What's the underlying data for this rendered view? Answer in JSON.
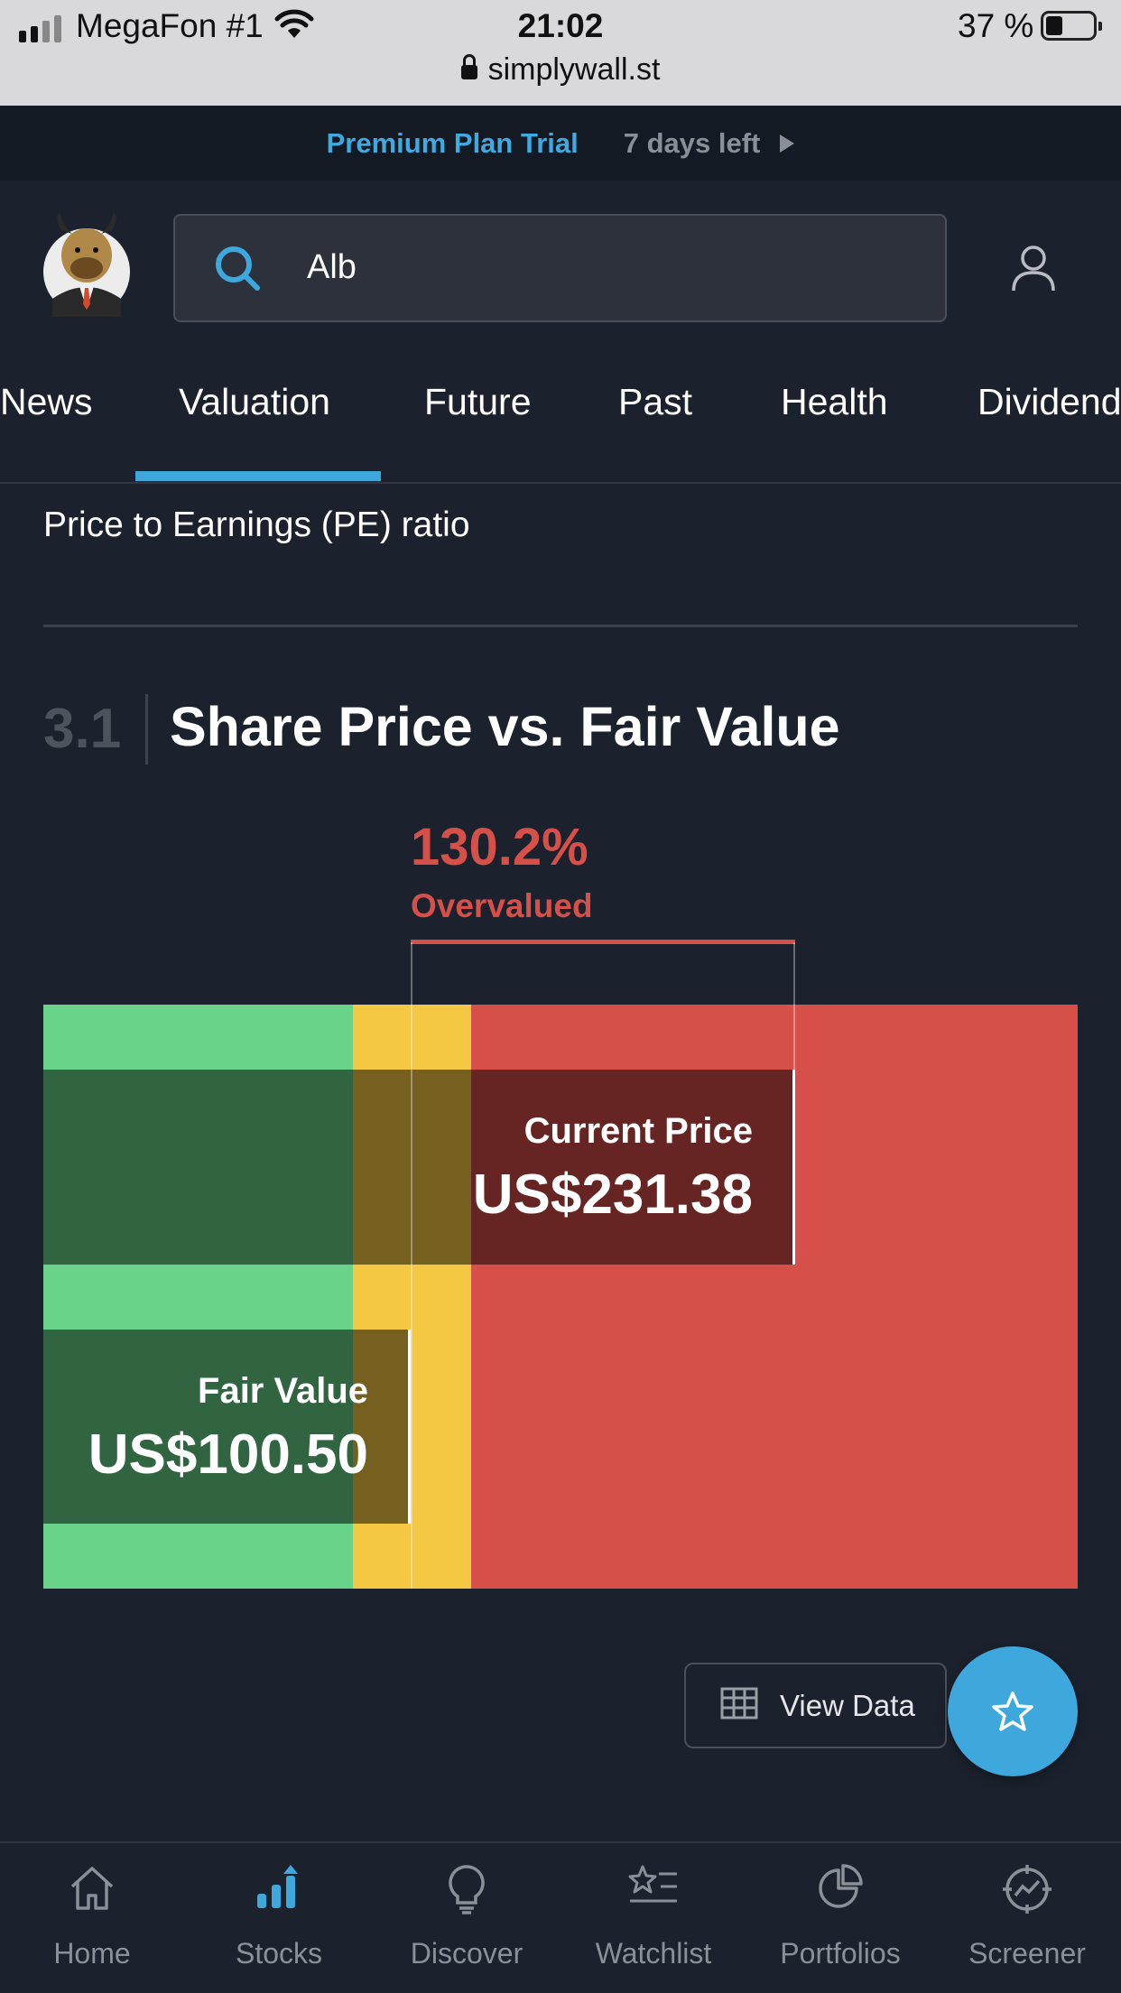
{
  "status_bar": {
    "carrier": "MegaFon #1",
    "time": "21:02",
    "battery": "37 %",
    "url": "simplywall.st"
  },
  "trial_banner": {
    "plan": "Premium Plan Trial",
    "remaining": "7 days left"
  },
  "search": {
    "value": "Alb"
  },
  "tabs": [
    {
      "label": "News"
    },
    {
      "label": "Valuation",
      "active": true
    },
    {
      "label": "Future"
    },
    {
      "label": "Past"
    },
    {
      "label": "Health"
    },
    {
      "label": "Dividend"
    }
  ],
  "content": {
    "pe_label": "Price to Earnings (PE) ratio",
    "section_number": "3.1",
    "section_title": "Share Price vs. Fair Value"
  },
  "valuation_chart": {
    "difference_pct": "130.2%",
    "verdict": "Overvalued",
    "current_price_label": "Current Price",
    "current_price": "US$231.38",
    "fair_value_label": "Fair Value",
    "fair_value": "US$100.50",
    "colors": {
      "undervalued": "#68d389",
      "about_right": "#f5c843",
      "overvalued": "#d64f48"
    }
  },
  "actions": {
    "view_data": "View Data"
  },
  "bottom_nav": [
    {
      "label": "Home",
      "icon": "home-icon"
    },
    {
      "label": "Stocks",
      "icon": "stocks-icon",
      "active": true
    },
    {
      "label": "Discover",
      "icon": "lightbulb-icon"
    },
    {
      "label": "Watchlist",
      "icon": "watchlist-icon"
    },
    {
      "label": "Portfolios",
      "icon": "pie-chart-icon"
    },
    {
      "label": "Screener",
      "icon": "screener-icon"
    }
  ]
}
